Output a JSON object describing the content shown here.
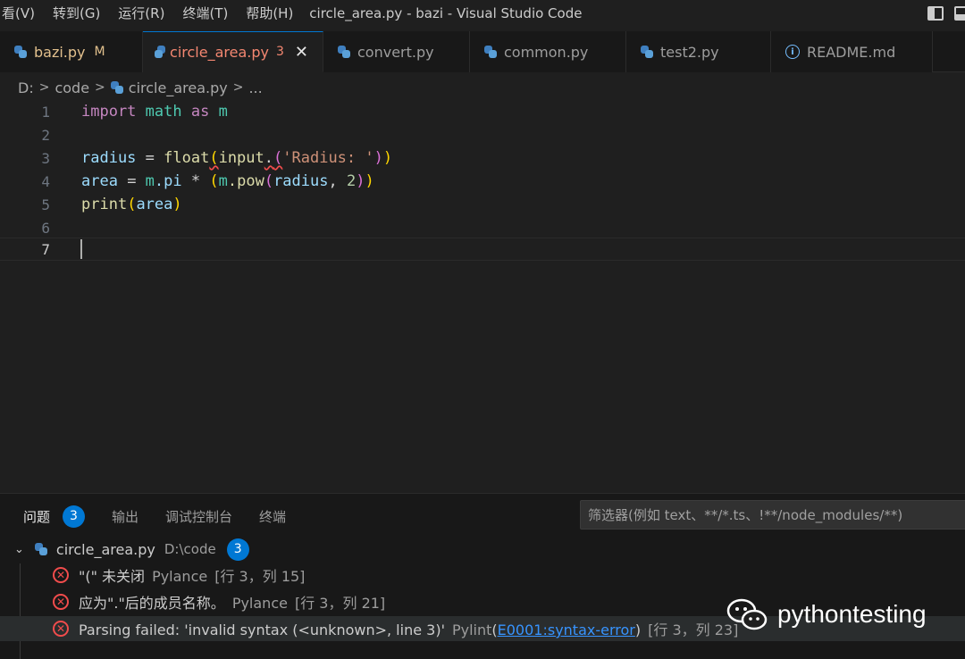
{
  "menu": [
    "看(V)",
    "转到(G)",
    "运行(R)",
    "终端(T)",
    "帮助(H)"
  ],
  "window_title": "circle_area.py - bazi - Visual Studio Code",
  "tabs": [
    {
      "label": "bazi.py",
      "badge": "M"
    },
    {
      "label": "circle_area.py",
      "badge": "3",
      "close": "✕"
    },
    {
      "label": "convert.py"
    },
    {
      "label": "common.py"
    },
    {
      "label": "test2.py"
    },
    {
      "label": "README.md"
    }
  ],
  "breadcrumb": {
    "drive": "D:",
    "folder": "code",
    "file": "circle_area.py",
    "more": "..."
  },
  "editor": {
    "line_numbers": [
      "1",
      "2",
      "3",
      "4",
      "5",
      "6",
      "7"
    ],
    "current_line": 7,
    "code": {
      "l1": {
        "kw1": "import",
        "mod": "math",
        "kw2": "as",
        "alias": "m"
      },
      "l3": {
        "var": "radius",
        "eq": " = ",
        "float": "float",
        "lp": "(",
        "input": "input",
        "dot": ".",
        "lp2": "(",
        "str": "'Radius: '",
        "rp2": ")",
        "rp": ")"
      },
      "l4": {
        "var": "area",
        "eq": " = ",
        "m": "m",
        "pi": ".pi",
        "mul": " * ",
        "lp": "(",
        "m2": "m",
        "pow": ".pow",
        "lp2": "(",
        "arg": "radius",
        "comma": ", ",
        "num": "2",
        "rp2": ")",
        "rp": ")"
      },
      "l5": {
        "print": "print",
        "lp": "(",
        "arg": "area",
        "rp": ")"
      }
    }
  },
  "panel": {
    "tabs": [
      {
        "label": "问题",
        "count": "3"
      },
      {
        "label": "输出"
      },
      {
        "label": "调试控制台"
      },
      {
        "label": "终端"
      }
    ],
    "filter_placeholder": "筛选器(例如 text、**/*.ts、!**/node_modules/**)",
    "file": {
      "name": "circle_area.py",
      "path": "D:\\code",
      "count": "3"
    },
    "problems": [
      {
        "message": "\"(\" 未关闭",
        "source": "Pylance",
        "location": "[行 3，列 15]"
      },
      {
        "message": "应为\".\"后的成员名称。",
        "source": "Pylance",
        "location": "[行 3，列 21]"
      },
      {
        "message": "Parsing failed: 'invalid syntax (<unknown>, line 3)'",
        "source": "Pylint",
        "code": "E0001:syntax-error",
        "location": "[行 3，列 23]"
      }
    ]
  },
  "watermark": {
    "text": "pythontesting"
  },
  "colors": {
    "accent": "#0078d4",
    "error": "#f14c4c",
    "keyword": "#c586c0",
    "function": "#dcdcaa",
    "variable": "#9cdcfe",
    "string": "#ce9178"
  }
}
